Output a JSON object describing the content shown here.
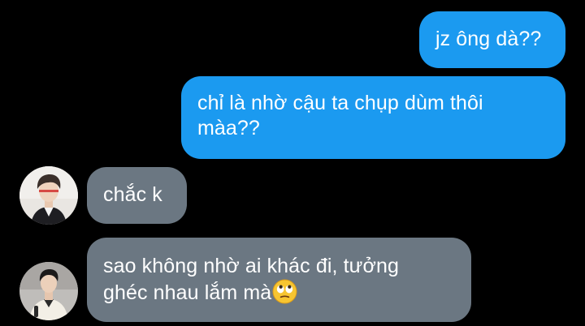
{
  "messages": [
    {
      "id": "m1",
      "direction": "sent",
      "text": "jz ông dà??"
    },
    {
      "id": "m2",
      "direction": "sent",
      "text_line1": "chỉ là nhờ cậu ta chụp dùm thôi",
      "text_line2": "màa??"
    },
    {
      "id": "m3",
      "direction": "received",
      "text": "chắc k"
    },
    {
      "id": "m4",
      "direction": "received",
      "text_line1": "sao không nhờ ai khác đi, tưởng",
      "text_line2": "ghéc nhau lắm mà",
      "emoji": "face-with-rolling-eyes-icon"
    }
  ],
  "colors": {
    "background": "#000000",
    "sent_bubble": "#1b9af0",
    "received_bubble": "#6b7782",
    "text": "#ffffff"
  }
}
